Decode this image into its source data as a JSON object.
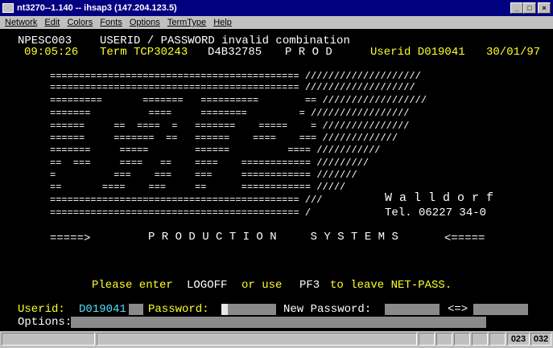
{
  "window": {
    "title": "nt3270--1.140  --  ihsap3 (147.204.123.5)",
    "buttons": [
      "_",
      "□",
      "×"
    ]
  },
  "menu": [
    "Network",
    "Edit",
    "Colors",
    "Fonts",
    "Options",
    "TermType",
    "Help"
  ],
  "header": {
    "panel_id": "NPESC003",
    "message": "USERID / PASSWORD invalid combination",
    "time": "09:05:26",
    "term_label": "Term TCP30243",
    "term_id": "D4B32785",
    "system": "P R O D",
    "userid_label": "Userid D019041",
    "date": "30/01/97"
  },
  "banner": [
    "=========================================== ////////////////////",
    "=========================================== ///////////////////",
    "=========       =======   ==========        == //////////////////",
    "=======          ====     ========         = /////////////////",
    "======     ==  ====  =   =======    =====    = ///////////////",
    "======     =======  ==   ======    ====    === /////////////",
    "=======     =====        ======          ==== ///////////",
    "==  ===     ====   ==    ====    ============ /////////",
    "=          ===    ===    ===     ============ ///////",
    "==       ====    ===     ==      ============ /////",
    "=========================================== ///",
    "=========================================== /"
  ],
  "walldorf": {
    "name": "W a l l d o r f",
    "phone": "Tel. 06227 34-0"
  },
  "production": {
    "left_arrow": "=====>",
    "text": "P R O D U C T I O N     S Y S T E M S",
    "right_arrow": "<====="
  },
  "instruction": {
    "part1": "Please enter",
    "logoff": "LOGOFF",
    "part2": "or use",
    "pf3": "PF3",
    "part3": "to leave NET-PASS."
  },
  "form": {
    "userid_label": "Userid:",
    "userid_value": "D019041",
    "password_label": "Password:",
    "new_password_label": "New Password:",
    "swap_label": "<=>",
    "options_label": "Options:"
  },
  "status": {
    "row": "023",
    "col": "032"
  }
}
